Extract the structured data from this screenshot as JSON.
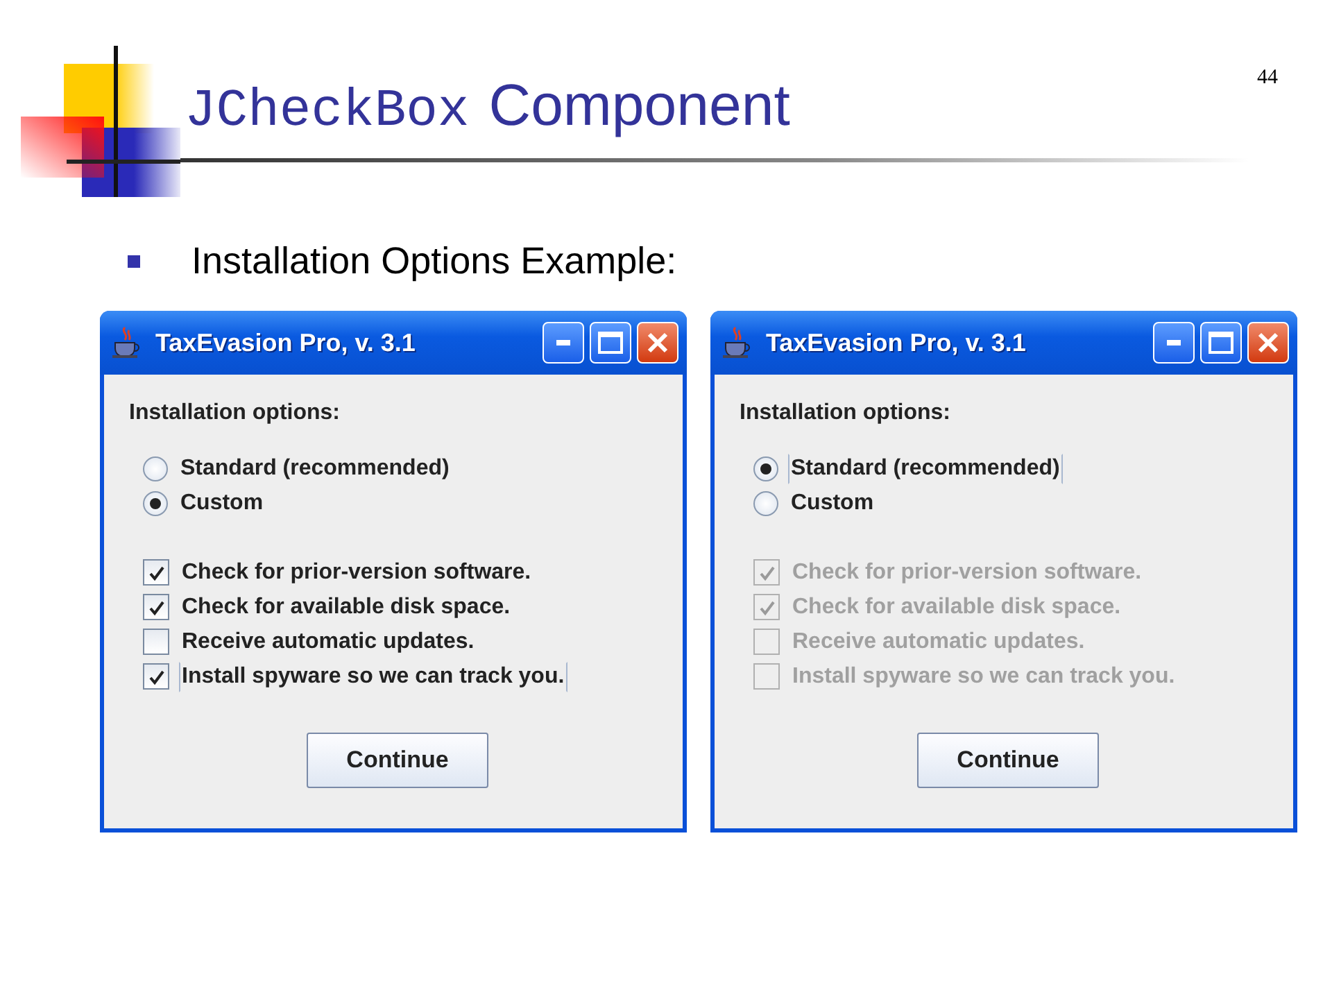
{
  "slide": {
    "number": "44",
    "title": {
      "code": "JCheckBox",
      "text": "Component"
    },
    "bullet": "Installation Options Example:"
  },
  "windows": [
    {
      "title": "TaxEvasion Pro, v. 3.1",
      "heading": "Installation options:",
      "radios": [
        {
          "label": "Standard (recommended)",
          "selected": false,
          "focused": false
        },
        {
          "label": "Custom",
          "selected": true,
          "focused": false
        }
      ],
      "checkboxes": [
        {
          "label": "Check for prior-version software.",
          "checked": true,
          "disabled": false,
          "focused": false
        },
        {
          "label": "Check for available disk space.",
          "checked": true,
          "disabled": false,
          "focused": false
        },
        {
          "label": "Receive automatic updates.",
          "checked": false,
          "disabled": false,
          "focused": false
        },
        {
          "label": "Install spyware so we can track you.",
          "checked": true,
          "disabled": false,
          "focused": true
        }
      ],
      "button": "Continue"
    },
    {
      "title": "TaxEvasion Pro, v. 3.1",
      "heading": "Installation options:",
      "radios": [
        {
          "label": "Standard (recommended)",
          "selected": true,
          "focused": true
        },
        {
          "label": "Custom",
          "selected": false,
          "focused": false
        }
      ],
      "checkboxes": [
        {
          "label": "Check for prior-version software.",
          "checked": true,
          "disabled": true,
          "focused": false
        },
        {
          "label": "Check for available disk space.",
          "checked": true,
          "disabled": true,
          "focused": false
        },
        {
          "label": "Receive automatic updates.",
          "checked": false,
          "disabled": true,
          "focused": false
        },
        {
          "label": "Install spyware so we can track you.",
          "checked": false,
          "disabled": true,
          "focused": false
        }
      ],
      "button": "Continue"
    }
  ]
}
